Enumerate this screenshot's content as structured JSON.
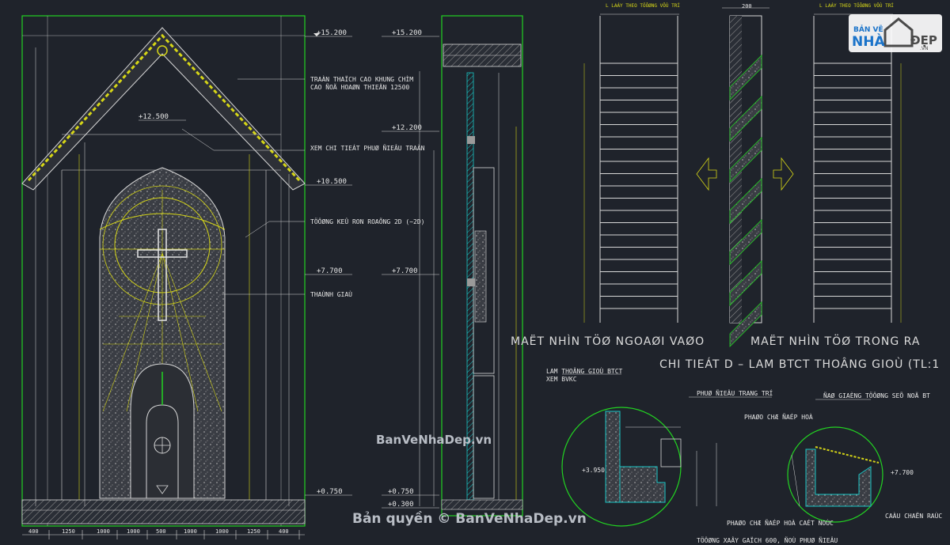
{
  "elev_labels": {
    "e15200a": "+15.200",
    "e15200b": "+15.200",
    "e12500": "+12.500",
    "e12200": "+12.200",
    "e10500": "+10.500",
    "e7700a": "+7.700",
    "e7700b": "+7.700",
    "e0750a": "+0.750",
    "e0750b": "+0.750",
    "e0300": "+0.300",
    "e3950": "+3.950",
    "e7700c": "+7.700"
  },
  "notes": {
    "n1a": "TRAÀN THAÏCH CAO KHUNG CHÌM",
    "n1b": "CAO ÑOÄ HOAØN THIEÄN 12500",
    "n2": "XEM CHI TIEÁT PHUØ ÑIEÂU TRAÀN",
    "n3": "TÖÔØNG KEÛ RON ROAÕNG 2D (~2D)",
    "n4": "THAÙNH GIAÙ"
  },
  "view_titles": {
    "outside": "MAËT NHÌN TÖØ NGOAØI VAØO",
    "inside": "MAËT NHÌN TÖØ TRONG RA",
    "detail": "CHI TIEÁT D – LAM BTCT THOÂNG GIOÙ   (TL:1"
  },
  "top_labels": {
    "l1": "L LAÁY THEO TÖÔØNG VÔÙ TRÍ",
    "l2": "L LAÁY THEO TÖÔØNG VÔÙ TRÍ",
    "w200": "200"
  },
  "detail_notes": {
    "d1": "LAM THOÂNG GIOÙ BTCT",
    "d2": "XEM BVKC",
    "d3": "PHUØ ÑIEÂU TRANG TRÍ",
    "d4": "ÑAØ GIAÈNG TÖÔØNG SEÕ NOÄ BT",
    "d5": "PHAØO CHÆ ÑAÉP HOÀ",
    "d6": "PHAØO CHÆ ÑAÉP HOÀ CAÉT NOÙC",
    "d7": "CAÀU CHAËN RAÙC",
    "d8": "TÖÔØNG XAÂY GAÏCH 600, ÑOÙ PHUØ ÑIEÂU"
  },
  "bottom_dims": [
    "400",
    "1250",
    "1000",
    "1000",
    "500",
    "1000",
    "1000",
    "1250",
    "400"
  ],
  "watermarks": {
    "site": "BanVeNhaDep.vn",
    "copyright": "Bản quyền © BanVeNhaDep.vn"
  },
  "logo": {
    "line1": "BẢN VẼ",
    "line2": "NHÀ",
    "line3": "ĐẸP",
    "url": ".VN"
  },
  "colors": {
    "background": "#1f232b",
    "frame": "#22d322",
    "annotation": "#d6d617",
    "hatch": "#19c5c5",
    "line": "#d7d7d7"
  }
}
